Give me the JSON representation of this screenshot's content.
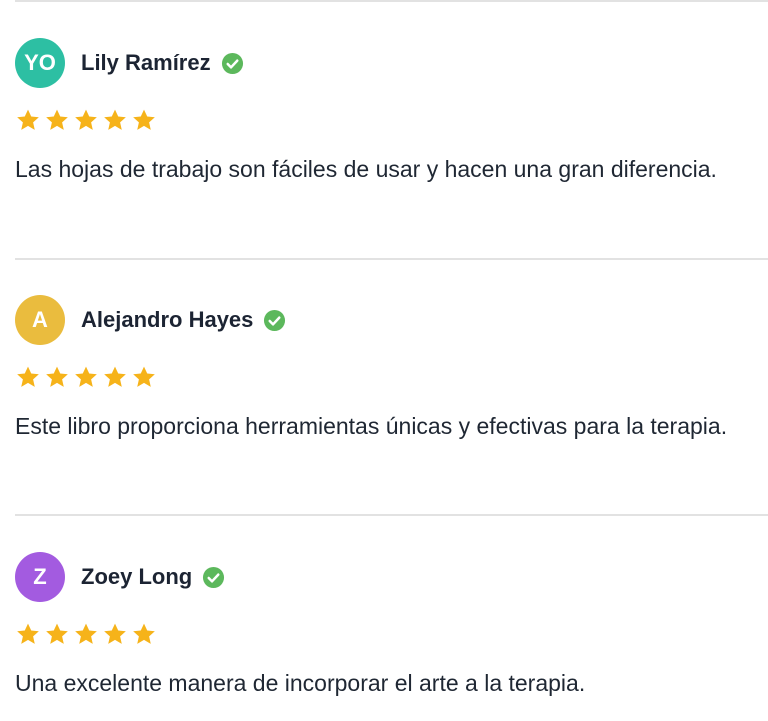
{
  "colors": {
    "verified": "#5cb85c",
    "star": "#f6b31a",
    "divider": "#e2e2e2"
  },
  "reviews": [
    {
      "initials": "YO",
      "avatar_color": "#2dbfa3",
      "name": "Lily Ramírez",
      "verified_icon": "check-circle-icon",
      "rating": 5,
      "text": "Las hojas de trabajo son fáciles de usar y hacen una gran diferencia."
    },
    {
      "initials": "A",
      "avatar_color": "#eabc3e",
      "name": "Alejandro Hayes",
      "verified_icon": "check-circle-icon",
      "rating": 5,
      "text": "Este libro proporciona herramientas únicas y efectivas para la terapia."
    },
    {
      "initials": "Z",
      "avatar_color": "#a35be0",
      "name": "Zoey Long",
      "verified_icon": "check-circle-icon",
      "rating": 5,
      "text": "Una excelente manera de incorporar el arte a la terapia."
    }
  ]
}
